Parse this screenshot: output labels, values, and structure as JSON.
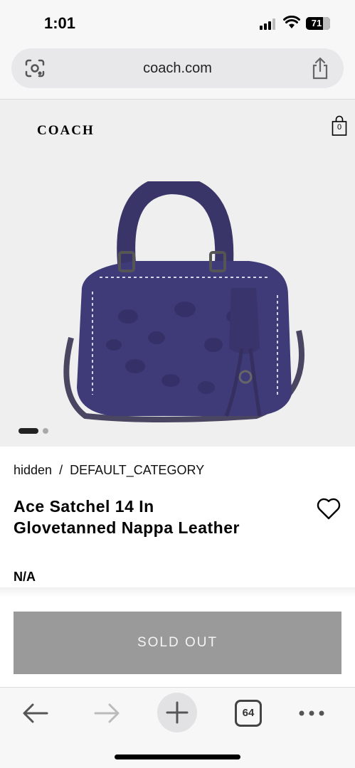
{
  "status_bar": {
    "time": "1:01",
    "battery": "71",
    "battery_level": 0.71
  },
  "browser": {
    "url": "coach.com",
    "icons": [
      "google-lens-icon",
      "share-icon"
    ]
  },
  "header": {
    "logo_text": "COACH",
    "bag_count": "0"
  },
  "gallery": {
    "image_name": "ace-satchel-purple-bag",
    "current_slide": 1,
    "total_slides": 2
  },
  "breadcrumb": {
    "items": [
      "hidden",
      "DEFAULT_CATEGORY"
    ],
    "separator": "/"
  },
  "product": {
    "title_line1": "Ace Satchel 14 In",
    "title_line2": "Glovetanned Nappa Leather",
    "price": "N/A"
  },
  "cta": {
    "label": "SOLD OUT"
  },
  "toolbar": {
    "tabs_count": "64",
    "icons": [
      "back-arrow-icon",
      "forward-arrow-icon",
      "plus-icon",
      "tabs-icon",
      "more-icon"
    ]
  },
  "colors": {
    "button_disabled": "#9a9a9a",
    "bag_purple": "#3f3a78"
  }
}
